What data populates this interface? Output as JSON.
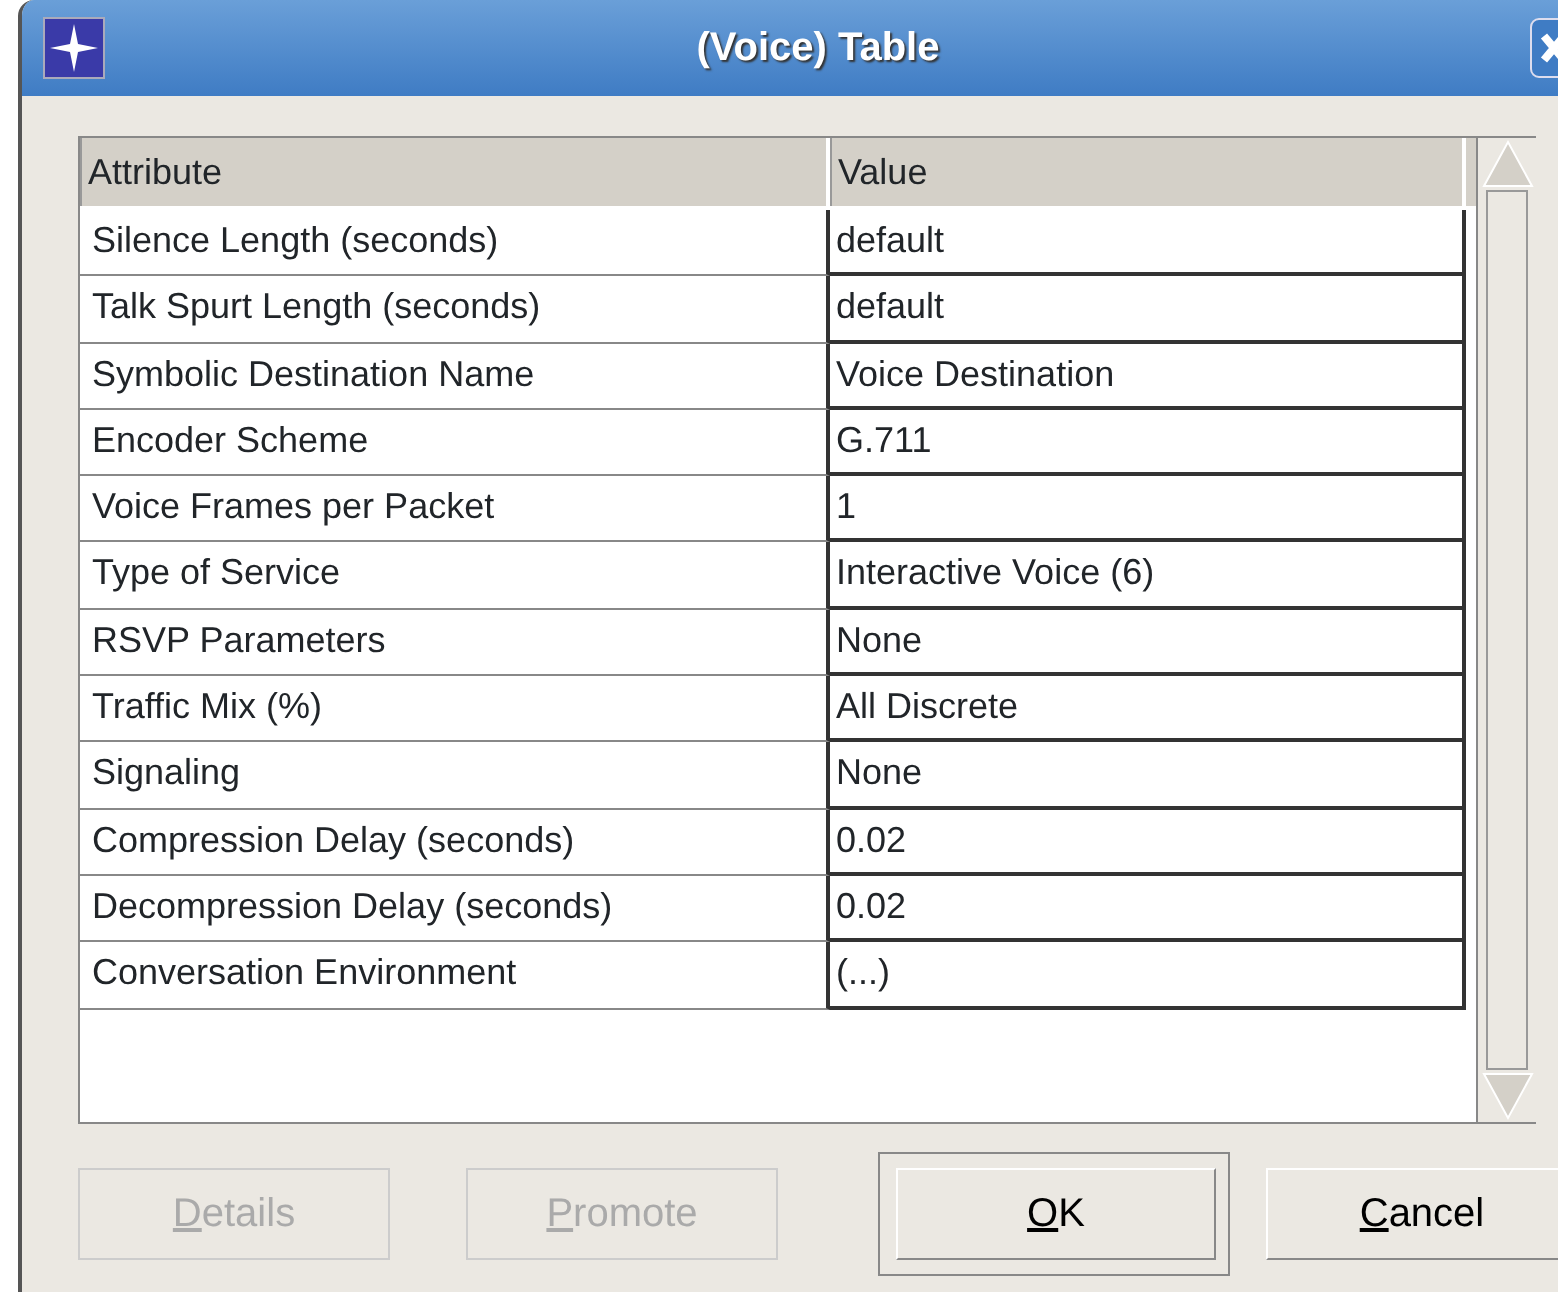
{
  "window": {
    "title": "(Voice) Table"
  },
  "table": {
    "columns": [
      "Attribute",
      "Value"
    ],
    "rows": [
      {
        "attribute": "Silence Length (seconds)",
        "value": "default"
      },
      {
        "attribute": "Talk Spurt Length (seconds)",
        "value": "default"
      },
      {
        "attribute": "Symbolic Destination Name",
        "value": "Voice Destination"
      },
      {
        "attribute": "Encoder Scheme",
        "value": "G.711"
      },
      {
        "attribute": "Voice Frames per Packet",
        "value": "1"
      },
      {
        "attribute": "Type of Service",
        "value": "Interactive Voice (6)"
      },
      {
        "attribute": "RSVP Parameters",
        "value": "None"
      },
      {
        "attribute": "Traffic Mix (%)",
        "value": "All Discrete"
      },
      {
        "attribute": "Signaling",
        "value": "None"
      },
      {
        "attribute": "Compression Delay (seconds)",
        "value": "0.02"
      },
      {
        "attribute": "Decompression Delay (seconds)",
        "value": "0.02"
      },
      {
        "attribute": "Conversation Environment",
        "value": "(...)"
      }
    ]
  },
  "buttons": [
    {
      "label": "Details",
      "disabled": true,
      "default": false
    },
    {
      "label": "Promote",
      "disabled": true,
      "default": false
    },
    {
      "label": "OK",
      "disabled": false,
      "default": true
    },
    {
      "label": "Cancel",
      "disabled": false,
      "default": false
    }
  ]
}
